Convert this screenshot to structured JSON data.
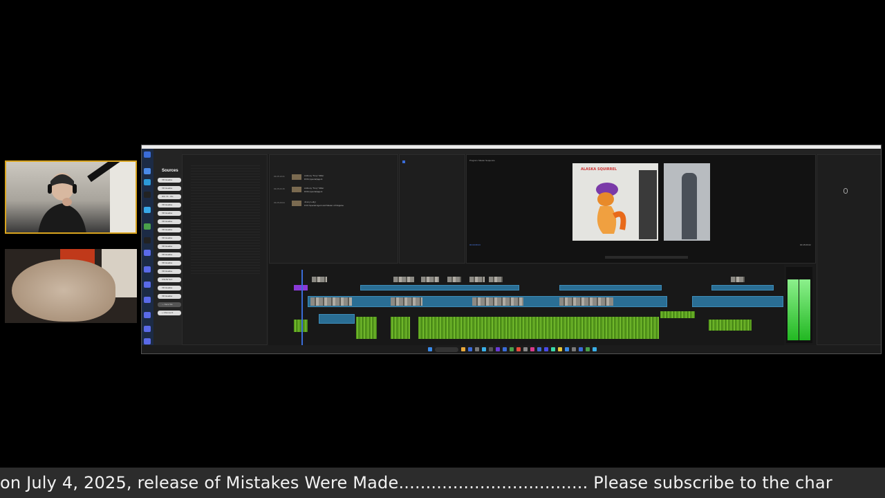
{
  "ticker": {
    "text": "on July 4, 2025, release of Mistakes Were Made................................... Please subscribe to the char"
  },
  "obs_sources": {
    "title": "Sources",
    "items": [
      "VR Headse",
      "VR Headse",
      "WC Y4 - Ws",
      "VR Headse",
      "VR Headse",
      "VR Headse",
      "VR Headse",
      "VR Headse",
      "VR Headse",
      "VR Headse",
      "VR Headse",
      "VR Headse",
      "OSUW Scrl",
      "VR Headse",
      "VR Headse",
      "— Face Ws",
      "+ Chrome D"
    ]
  },
  "project_clips": [
    {
      "time": "03:25:10:21",
      "name": "Anthony \"Tony\" Miller",
      "role": "DVM (special)agent"
    },
    {
      "time": "03:25:23:15",
      "name": "Anthony \"Tony\" Miller",
      "role": "DVM (special)agent"
    },
    {
      "time": "03:25:29:04",
      "name": "Jimmy Lolly)",
      "role": "FCO Special Agent and Master of Disguise"
    }
  ],
  "program_monitor": {
    "title": "Program: Master Sequence",
    "poster_text": "ALASKA SQUIRREL",
    "timecode_left": "00:00:08:23",
    "timecode_right": "00:45:06:02"
  },
  "icons": [
    "obs-sidebar-icon",
    "play-icon",
    "search-icon",
    "windows-start-icon"
  ],
  "colors": {
    "cam_border": "#d9a41e",
    "video_clip": "#2a6e94",
    "audio_clip": "#5a9e1e",
    "ticker_bg": "#2c2c2c"
  }
}
